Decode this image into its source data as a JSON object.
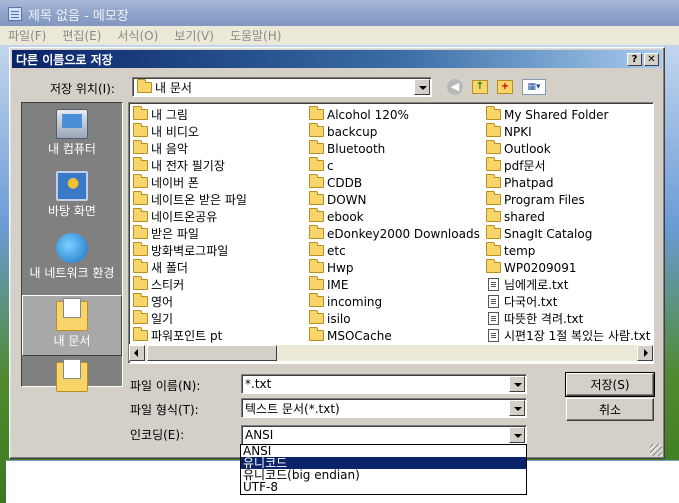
{
  "notepad": {
    "title": "제목 없음 - 메모장",
    "menu": [
      "파일(F)",
      "편집(E)",
      "서식(O)",
      "보기(V)",
      "도움말(H)"
    ]
  },
  "dialog": {
    "title": "다른 이름으로 저장",
    "help_label": "?",
    "close_label": "✕",
    "location_label": "저장 위치(I):",
    "location_value": "내 문서",
    "toolbar": {
      "back": "◀",
      "up": "↑",
      "new_folder": "+",
      "view": "▦▾"
    },
    "places": [
      "내 컴퓨터",
      "바탕 화면",
      "내 네트워크 환경",
      "내 문서",
      ""
    ],
    "files_col1": [
      "내 그림",
      "내 비디오",
      "내 음악",
      "내 전자 필기장",
      "네이버 폰",
      "네이트온 받은 파일",
      "네이트온공유",
      "받은 파일",
      "방화벽로그파일",
      "새 폴더",
      "스티커",
      "영어",
      "일기",
      "파워포인트 pt"
    ],
    "files_col2": [
      "Alcohol 120%",
      "backcup",
      "Bluetooth",
      "c",
      "CDDB",
      "DOWN",
      "ebook",
      "eDonkey2000 Downloads",
      "etc",
      "Hwp",
      "IME",
      "incoming",
      "isilo",
      "MSOCache"
    ],
    "files_col3": [
      "My Shared Folder",
      "NPKI",
      "Outlook",
      "pdf문서",
      "Phatpad",
      "Program Files",
      "shared",
      "SnagIt Catalog",
      "temp",
      "WP0209091",
      "님에게로.txt",
      "다국어.txt",
      "따뜻한 격려.txt",
      "시편1장 1절 복있는 사람.txt"
    ],
    "file_name_label": "파일 이름(N):",
    "file_name_value": "*.txt",
    "file_type_label": "파일 형식(T):",
    "file_type_value": "텍스트 문서(*.txt)",
    "encoding_label": "인코딩(E):",
    "encoding_value": "ANSI",
    "encoding_options": [
      "ANSI",
      "유니코드",
      "유니코드(big endian)",
      "UTF-8"
    ],
    "encoding_selected_index": 1,
    "save_label": "저장(S)",
    "cancel_label": "취소"
  }
}
